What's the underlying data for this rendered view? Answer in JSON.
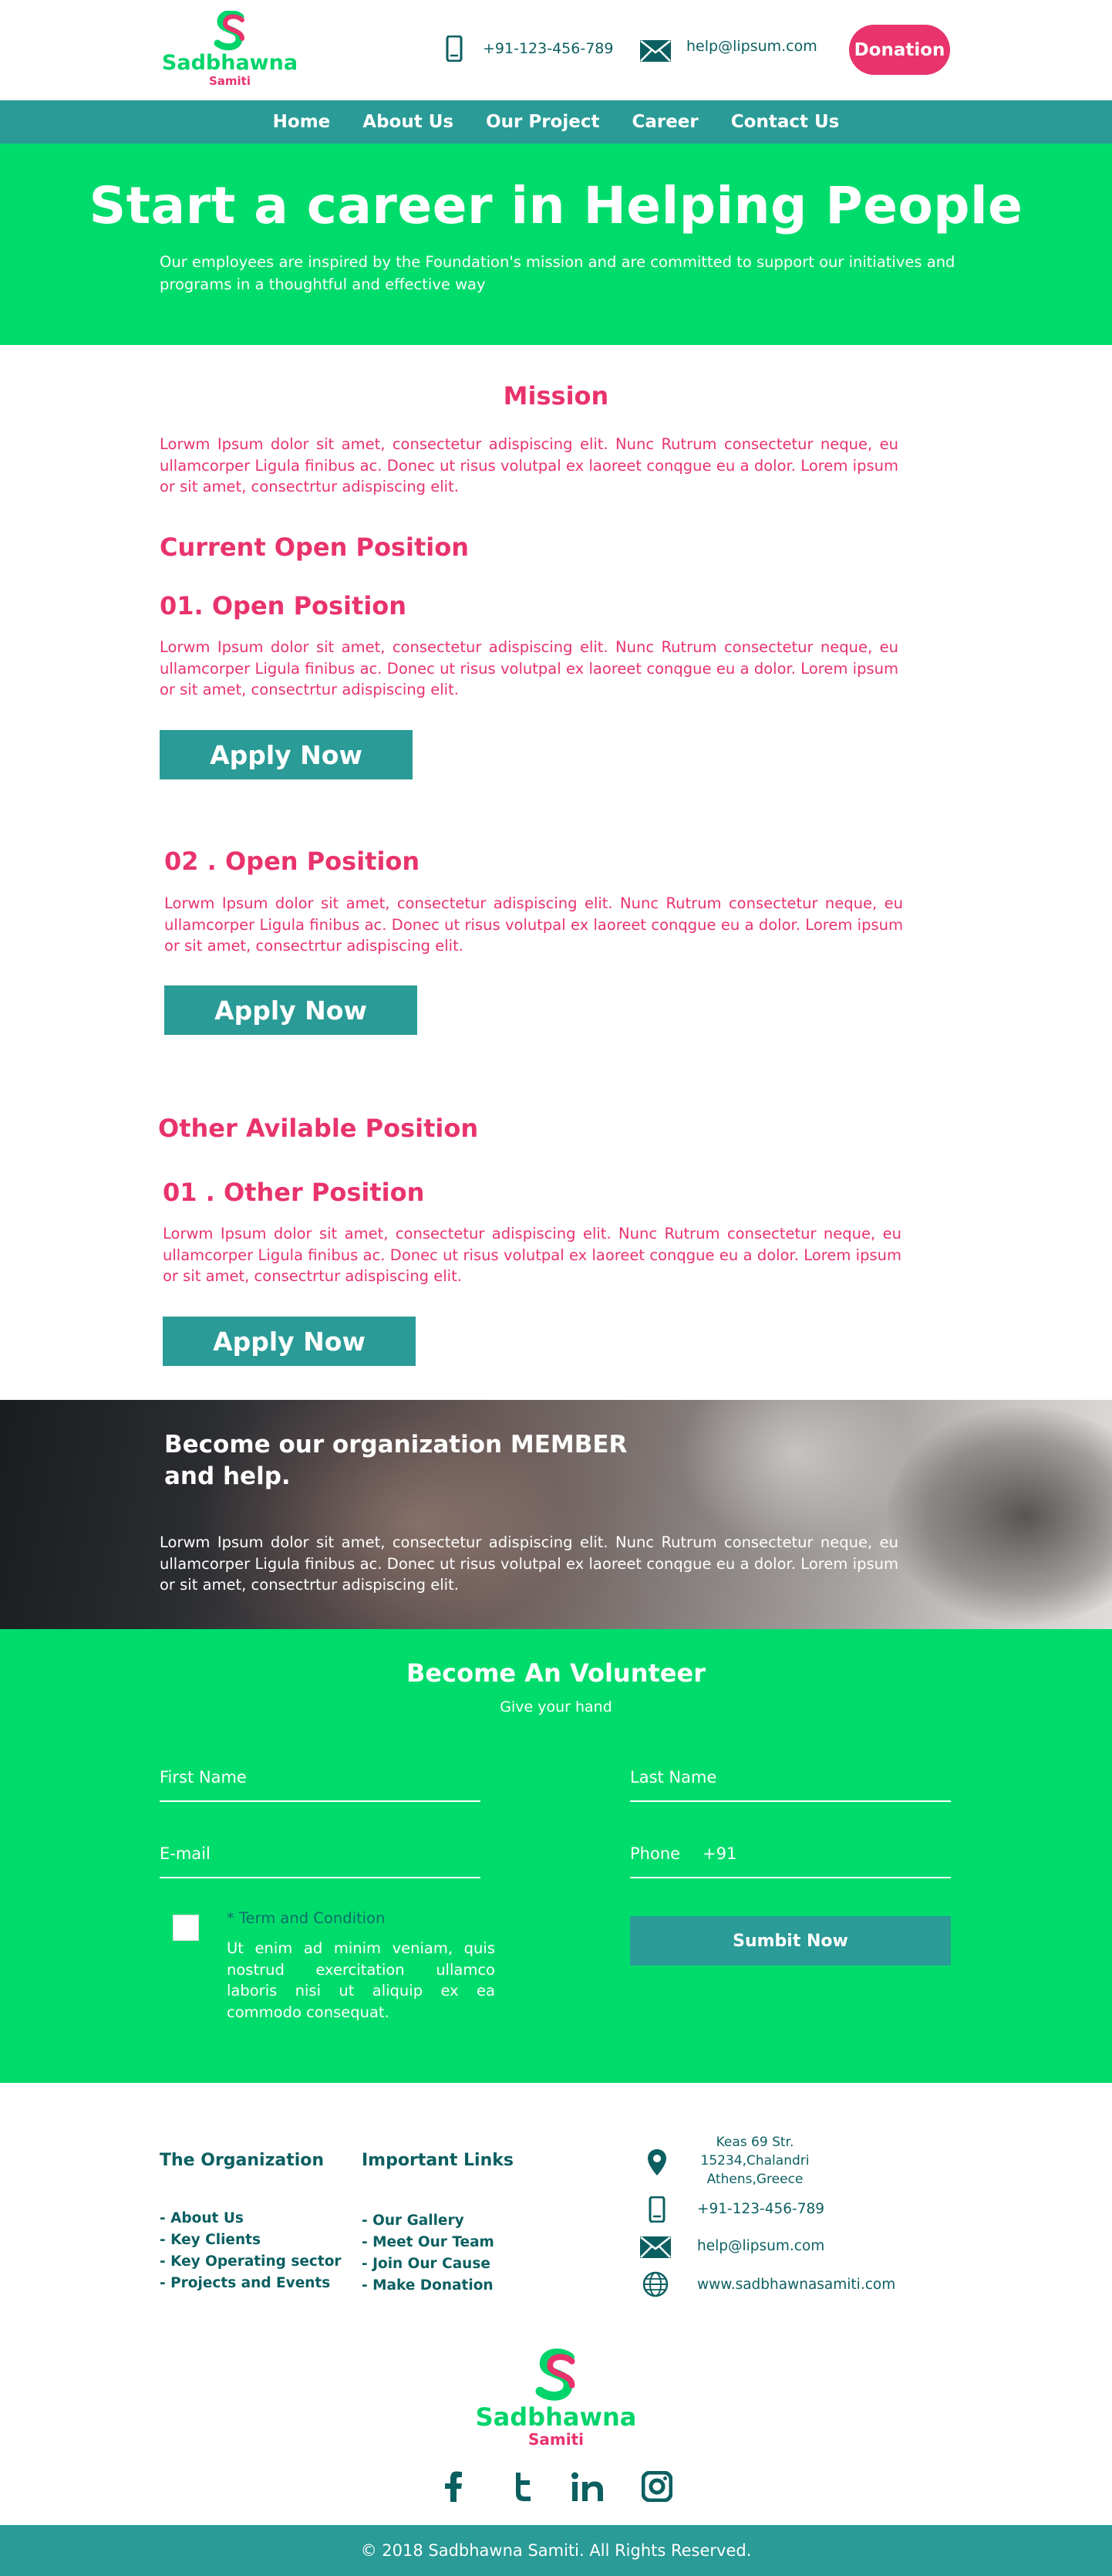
{
  "header": {
    "logo": {
      "brand": "Sadbhawna",
      "sub": "Samiti"
    },
    "phone": "+91-123-456-789",
    "email": "help@lipsum.com",
    "donation_label": "Donation"
  },
  "nav": {
    "items": [
      "Home",
      "About Us",
      "Our Project",
      "Career",
      "Contact Us"
    ]
  },
  "hero": {
    "title": "Start a career in Helping People",
    "text": "Our employees are inspired by the Foundation's mission and are committed to support our initiatives and  programs in a thoughtful and effective way"
  },
  "mission": {
    "title": "Mission",
    "text": "Lorwm Ipsum dolor sit amet, consectetur adispiscing elit. Nunc Rutrum consectetur neque, eu ullamcorper  Ligula finibus ac. Donec ut risus volutpal ex laoreet conqgue eu a dolor. Lorem ipsum or sit amet, consectrtur adispiscing elit."
  },
  "current": {
    "title": "Current Open Position",
    "positions": [
      {
        "title": "01. Open Position",
        "text": "Lorwm Ipsum dolor sit amet, consectetur adispiscing elit. Nunc Rutrum consectetur neque, eu ullamcorper  Ligula finibus ac. Donec ut risus volutpal ex laoreet conqgue eu a dolor. Lorem ipsum or sit amet, consectrtur adispiscing elit.",
        "button": "Apply Now"
      },
      {
        "title": "02 . Open Position",
        "text": "Lorwm Ipsum dolor sit amet, consectetur adispiscing elit. Nunc Rutrum consectetur neque, eu ullamcorper  Ligula finibus ac. Donec ut risus volutpal ex laoreet conqgue eu a dolor. Lorem ipsum or sit amet, consectrtur adispiscing elit.",
        "button": "Apply Now"
      }
    ]
  },
  "other": {
    "title": "Other Avilable Position",
    "positions": [
      {
        "title": "01 . Other Position",
        "text": "Lorwm Ipsum dolor sit amet, consectetur adispiscing elit. Nunc Rutrum consectetur neque, eu ullamcorper  Ligula finibus ac. Donec ut risus volutpal ex laoreet conqgue eu a dolor. Lorem ipsum or sit amet, consectrtur adispiscing elit.",
        "button": "Apply Now"
      }
    ]
  },
  "member": {
    "title": "Become our organization MEMBER and help.",
    "text": "Lorwm Ipsum dolor sit amet, consectetur adispiscing elit. Nunc Rutrum consectetur neque, eu ullamcorper  Ligula finibus ac. Donec ut risus volutpal ex laoreet conqgue eu a dolor. Lorem ipsum or sit amet, consectrtur adispiscing elit."
  },
  "volunteer": {
    "title": "Become An Volunteer",
    "subtitle": "Give your hand",
    "first_name": "First Name",
    "last_name": "Last Name",
    "email": "E-mail",
    "phone": "Phone",
    "phone_code": "+91",
    "terms_label": "* Term and Condition",
    "terms_text": "Ut enim ad minim veniam, quis nostrud exercitation ullamco laboris nisi ut aliquip ex ea commodo consequat.",
    "submit": "Sumbit Now"
  },
  "footer": {
    "org_title": "The Organization",
    "org_links": [
      "- About Us",
      "- Key Clients",
      "- Key Operating sector",
      "- Projects and Events"
    ],
    "links_title": "Important Links",
    "links": [
      "- Our Gallery",
      "- Meet Our Team",
      "- Join Our Cause",
      "- Make Donation"
    ],
    "address": [
      "Keas 69 Str.",
      "15234,Chalandri",
      "Athens,Greece"
    ],
    "phone": "+91-123-456-789",
    "email": "help@lipsum.com",
    "website": "www.sadbhawnasamiti.com",
    "logo": {
      "brand": "Sadbhawna",
      "sub": "Samiti"
    },
    "social": [
      "facebook-icon",
      "twitter-icon",
      "linkedin-icon",
      "instagram-icon"
    ],
    "copyright": "© 2018 Sadbhawna Samiti. All Rights Reserved."
  },
  "colors": {
    "green": "#00dc6c",
    "teal": "#2a9b97",
    "pink": "#e8336c",
    "dark_teal": "#0c5f61"
  }
}
